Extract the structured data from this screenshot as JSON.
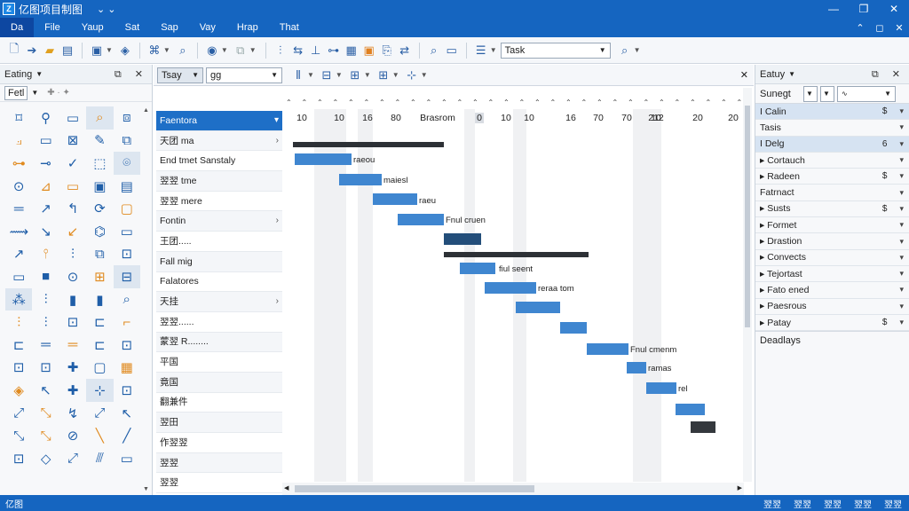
{
  "window": {
    "title": "亿图项目制图",
    "quick_access": "⌄ ⌄",
    "minimize": "—",
    "restore": "❐",
    "close": "✕"
  },
  "menu": {
    "items": [
      "Da",
      "File",
      "Yaup",
      "Sat",
      "Sap",
      "Vay",
      "Hrap",
      "That"
    ],
    "right_icons": [
      "⌃",
      "◻",
      "✕"
    ]
  },
  "toolbar": {
    "task_combo": "Task",
    "task_combo_value": ""
  },
  "left_panel": {
    "title": "Eating",
    "library": "Fetl",
    "controls": "⧉ ✕"
  },
  "center": {
    "combo1": "Tsay",
    "combo2": "gg",
    "tasks": [
      "Faentora",
      "天团 ma",
      "End tmet Sanstaly",
      "翌翌 tme",
      "翌翌 mere",
      "Fontin",
      "王团.....",
      "Fall mig",
      "Falatores",
      "天挂",
      "翌翌......",
      "蒙翌 R........",
      "平国",
      "竟国",
      "翻兼件",
      "翌田",
      "作翌翌",
      "翌翌",
      "翌翌"
    ],
    "scale_numbers": [
      "10",
      "10",
      "16",
      "80",
      "Brasrom",
      "0",
      "10",
      "10",
      "16",
      "70",
      "70",
      "10",
      "212",
      "20",
      "20"
    ],
    "bar_labels": [
      "raeou",
      "maiesl",
      "raeu",
      "Fnul cruen",
      "fiul seent",
      "reraa tom",
      "",
      "",
      "Fnul cmenm",
      "ramas",
      "rel"
    ]
  },
  "right_panel": {
    "title": "Eatuy",
    "controls": "⧉ ✕",
    "style": "Sunegt",
    "footer": "Deadlays",
    "properties": [
      {
        "name": "I Calin",
        "value": "$",
        "hl": true
      },
      {
        "name": "Tasis",
        "value": "",
        "hl": false
      },
      {
        "name": "I Delg",
        "value": "6",
        "hl": true
      },
      {
        "name": "▸ Cortauch",
        "value": "",
        "hl": false
      },
      {
        "name": "▸ Radeen",
        "value": "$",
        "hl": false
      },
      {
        "name": "Fatrnact",
        "value": "",
        "hl": false
      },
      {
        "name": "▸ Susts",
        "value": "$",
        "hl": false
      },
      {
        "name": "▸ Formet",
        "value": "",
        "hl": false
      },
      {
        "name": "▸ Drastion",
        "value": "",
        "hl": false
      },
      {
        "name": "▸ Convects",
        "value": "",
        "hl": false
      },
      {
        "name": "▸ Tejortast",
        "value": "",
        "hl": false
      },
      {
        "name": "▸ Fato ened",
        "value": "",
        "hl": false
      },
      {
        "name": "▸ Paesrous",
        "value": "",
        "hl": false
      },
      {
        "name": "▸ Patay",
        "value": "$",
        "hl": false
      }
    ]
  },
  "status": {
    "left": "亿图",
    "right": [
      "翌翌",
      "翌翌",
      "翌翌",
      "翌翌",
      "翌翌"
    ]
  }
}
